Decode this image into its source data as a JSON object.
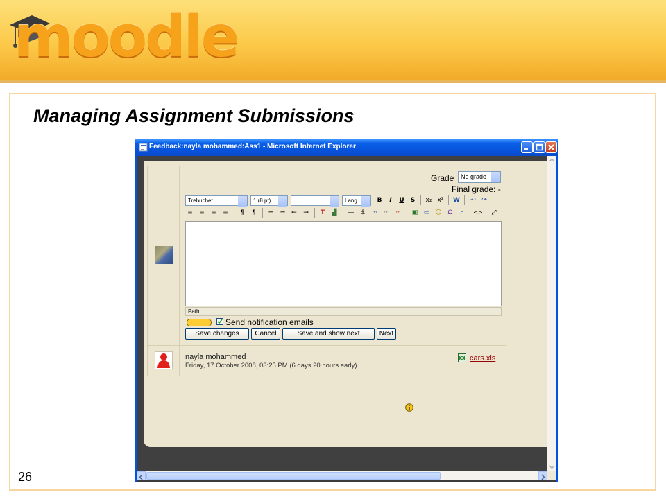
{
  "logo": {
    "text": "moodle"
  },
  "slide": {
    "title": "Managing Assignment Submissions",
    "page_number": "26"
  },
  "window": {
    "title": "Feedback:nayla mohammed:Ass1 - Microsoft Internet Explorer"
  },
  "grading": {
    "grade_label": "Grade",
    "grade_value": "No grade",
    "final_grade": "Final grade: -"
  },
  "toolbar": {
    "font": "Trebuchet",
    "size": "1 (8 pt)",
    "style": "",
    "lang": "Lang",
    "bold": "B",
    "italic": "I",
    "underline": "U",
    "strike": "S",
    "subscript": "x₂",
    "superscript": "x²",
    "word": "W",
    "undo": "↶",
    "redo": "↷",
    "align_left": "≡",
    "align_center": "≡",
    "align_right": "≡",
    "justify": "≡",
    "ltr": "¶",
    "rtl": "¶",
    "ordered": "≔",
    "unordered": "≔",
    "outdent": "⇤",
    "indent": "⇥",
    "text_color": "T",
    "bg_color": "▟",
    "hr": "—",
    "anchor": "⚓",
    "link": "∞",
    "unlink": "∞",
    "nolink": "∞",
    "image": "▣",
    "table": "▭",
    "smiley": "☺",
    "special": "Ω",
    "search": "⌕",
    "html": "<>",
    "fullscreen": "⤢"
  },
  "editor": {
    "path_label": "Path:"
  },
  "notification": {
    "checked": true,
    "label": "Send notification emails"
  },
  "buttons": {
    "save": "Save changes",
    "cancel": "Cancel",
    "save_next": "Save and show next",
    "next": "Next"
  },
  "submission": {
    "user": "nayla mohammed",
    "time": "Friday, 17 October 2008, 03:25 PM (6 days 20 hours early)",
    "file": "cars.xls"
  },
  "colors": {
    "banner": "#fcc948",
    "page_cream": "#ece5cf",
    "titlebar": "#0752d9",
    "file_link": "#990000"
  }
}
